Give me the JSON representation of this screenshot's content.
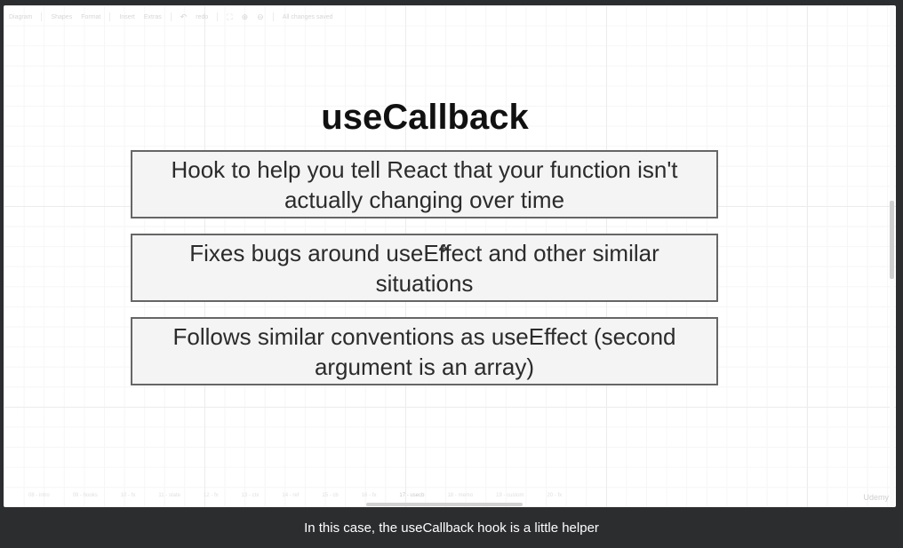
{
  "toolbar": {
    "diagram_menu": "Diagram",
    "shapes_menu": "Shapes",
    "format_menu": "Format",
    "insert_menu": "Insert",
    "extras_menu": "Extras",
    "undo_icon": "undo-icon",
    "redo_label": "redo",
    "fullscreen_icon": "fullscreen-icon",
    "zoom_in_icon": "zoom-in-icon",
    "zoom_out_icon": "zoom-out-icon",
    "status": "All changes saved"
  },
  "slide": {
    "title": "useCallback",
    "points": [
      "Hook to help you tell React that your function isn't actually changing over time",
      "Fixes bugs around useEffect and other similar situations",
      "Follows similar conventions as useEffect (second argument is an array)"
    ]
  },
  "page_tabs": [
    "08 - intro",
    "09 - hooks",
    "10 - fx",
    "11 - state",
    "12 - fx",
    "13 - ctx",
    "14 - ref",
    "15 - cb",
    "16 - fx",
    "17 - usecb",
    "18 - memo",
    "19 - custom",
    "20 - fx"
  ],
  "watermark": "Udemy",
  "caption": "In this case, the useCallback hook is a little helper",
  "colors": {
    "background": "#2c2d2f",
    "box_fill": "#f4f4f5",
    "box_border": "#666666",
    "title": "#111111"
  }
}
